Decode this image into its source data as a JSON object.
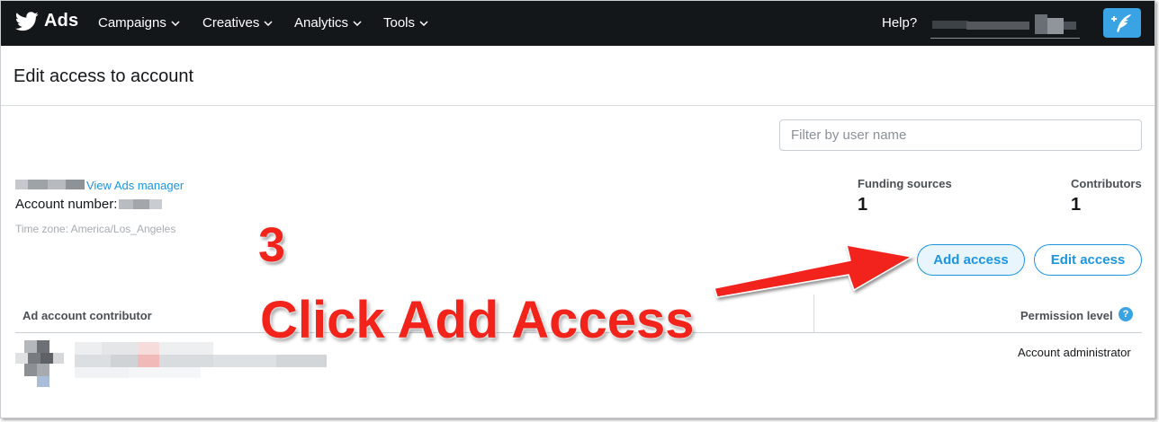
{
  "nav": {
    "brand": "Ads",
    "items": [
      {
        "label": "Campaigns"
      },
      {
        "label": "Creatives"
      },
      {
        "label": "Analytics"
      },
      {
        "label": "Tools"
      }
    ],
    "help": "Help?"
  },
  "page": {
    "title": "Edit access to account"
  },
  "filter": {
    "placeholder": "Filter by user name",
    "value": ""
  },
  "account": {
    "view_link": "View Ads manager",
    "number_label": "Account number:",
    "timezone": "Time zone: America/Los_Angeles"
  },
  "stats": {
    "funding_label": "Funding sources",
    "funding_value": "1",
    "contributors_label": "Contributors",
    "contributors_value": "1"
  },
  "actions": {
    "add_access": "Add access",
    "edit_access": "Edit access"
  },
  "table": {
    "col_contributor": "Ad account contributor",
    "col_permission": "Permission level",
    "help_glyph": "?",
    "rows": [
      {
        "permission": "Account administrator"
      }
    ]
  },
  "annotation": {
    "step": "3",
    "instruction": "Click Add Access",
    "color": "#f2231b"
  },
  "colors": {
    "nav_bg": "#14171a",
    "link": "#1b95e0",
    "compose_btn": "#3aa3e3"
  }
}
